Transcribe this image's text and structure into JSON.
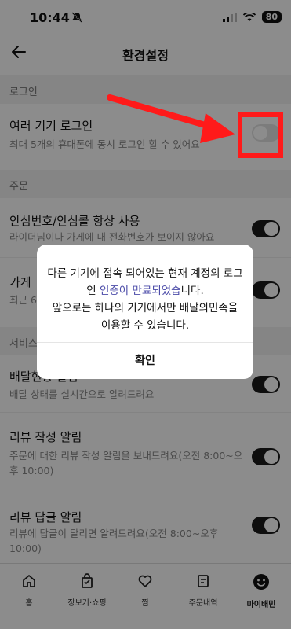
{
  "status": {
    "time": "10:44",
    "battery": "80"
  },
  "header": {
    "title": "환경설정"
  },
  "sections": [
    {
      "label": "로그인",
      "rows": [
        {
          "title": "여러 기기 로그인",
          "desc": "최대 5개의 휴대폰에 동시 로그인 할 수 있어요",
          "toggle": "off"
        }
      ]
    },
    {
      "label": "주문",
      "rows": [
        {
          "title": "안심번호/안심콜 항상 사용",
          "desc": "라이더님이나 가게에 내 전화번호가 보이지 않아요",
          "toggle": "on"
        },
        {
          "title": "가게",
          "desc": "최근 6",
          "toggle": "on"
        }
      ]
    },
    {
      "label": "서비스",
      "rows": [
        {
          "title": "배달현황 알림",
          "desc": "배달 상태를 실시간으로 알려드려요",
          "toggle": "on"
        },
        {
          "title": "리뷰 작성 알림",
          "desc": "주문에 대한 리뷰 작성 알림을 보내드려요(오전 8:00~오후 10:00)",
          "toggle": "on"
        },
        {
          "title": "리뷰 답글 알림",
          "desc": "리뷰에 답글이 달리면 알려드려요(오전 8:00~오후 10:00)",
          "toggle": "on"
        }
      ]
    }
  ],
  "tabs": [
    {
      "label": "홈",
      "icon": "home-icon"
    },
    {
      "label": "장보기·쇼핑",
      "icon": "shopping-bag-icon"
    },
    {
      "label": "찜",
      "icon": "heart-icon"
    },
    {
      "label": "주문내역",
      "icon": "receipt-icon"
    },
    {
      "label": "마이배민",
      "icon": "smile-face-icon"
    }
  ],
  "modal": {
    "msg_part1": "다른 기기에 접속 되어있는 현재 계정의 로그인 ",
    "msg_link": "인증이 만료되었습",
    "msg_part2": "니다.",
    "msg_line2": "앞으로는 하나의 기기에서만 배달의민족을 이용할 수 있습니다.",
    "confirm_label": "확인"
  },
  "colors": {
    "annotation": "#ff1a1a",
    "toggle_on": "#1a1a1a",
    "toggle_off": "#e2e2e2"
  }
}
